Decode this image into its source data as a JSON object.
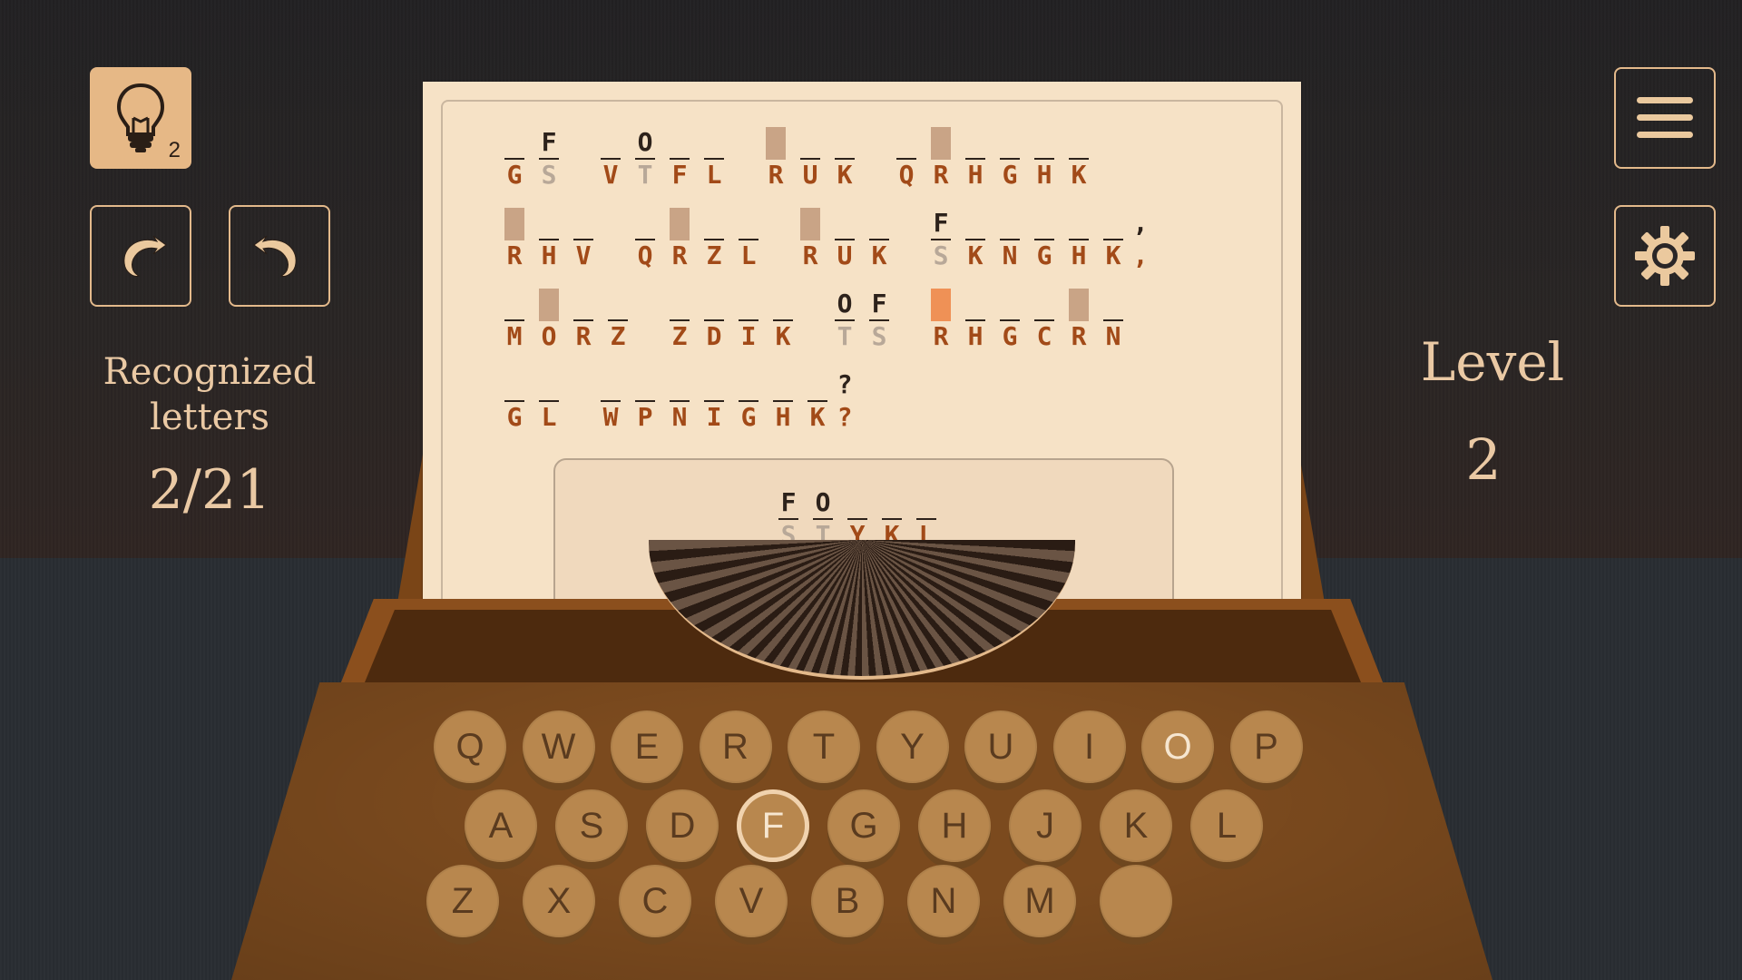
{
  "hud": {
    "hint_count": "2",
    "recognized_label": "Recognized letters",
    "recognized_count": "2/21",
    "level_label": "Level",
    "level_number": "2"
  },
  "icons": {
    "hint": "lightbulb-icon",
    "undo": "undo-arrow-icon",
    "redo": "redo-arrow-icon",
    "menu": "hamburger-menu-icon",
    "settings": "gear-icon"
  },
  "colors": {
    "accent": "#e6b886",
    "cipher_text": "#a24a18",
    "selected_cell": "#ef9156",
    "hinted_cell": "#c9a486",
    "paper": "#f6e2c6",
    "typewriter_body": "#7b4a1e"
  },
  "puzzle": {
    "lines": [
      [
        [
          {
            "g": "",
            "c": "G",
            "s": "uline"
          },
          {
            "g": "F",
            "c": "S",
            "s": "uline",
            "f": true
          }
        ],
        [
          {
            "g": "",
            "c": "V",
            "s": "uline"
          },
          {
            "g": "O",
            "c": "T",
            "s": "uline",
            "f": true
          },
          {
            "g": "",
            "c": "F",
            "s": "uline"
          },
          {
            "g": "",
            "c": "L",
            "s": "uline"
          }
        ],
        [
          {
            "g": "",
            "c": "R",
            "s": "shade"
          },
          {
            "g": "",
            "c": "U",
            "s": "uline"
          },
          {
            "g": "",
            "c": "K",
            "s": "uline"
          }
        ],
        [
          {
            "g": "",
            "c": "Q",
            "s": "uline"
          },
          {
            "g": "",
            "c": "R",
            "s": "shade"
          },
          {
            "g": "",
            "c": "H",
            "s": "uline"
          },
          {
            "g": "",
            "c": "G",
            "s": "uline"
          },
          {
            "g": "",
            "c": "H",
            "s": "uline"
          },
          {
            "g": "",
            "c": "K",
            "s": "uline"
          }
        ]
      ],
      [
        [
          {
            "g": "",
            "c": "R",
            "s": "shade"
          },
          {
            "g": "",
            "c": "H",
            "s": "uline"
          },
          {
            "g": "",
            "c": "V",
            "s": "uline"
          }
        ],
        [
          {
            "g": "",
            "c": "Q",
            "s": "uline"
          },
          {
            "g": "",
            "c": "R",
            "s": "shade"
          },
          {
            "g": "",
            "c": "Z",
            "s": "uline"
          },
          {
            "g": "",
            "c": "L",
            "s": "uline"
          }
        ],
        [
          {
            "g": "",
            "c": "R",
            "s": "shade"
          },
          {
            "g": "",
            "c": "U",
            "s": "uline"
          },
          {
            "g": "",
            "c": "K",
            "s": "uline"
          }
        ],
        [
          {
            "g": "F",
            "c": "S",
            "s": "uline",
            "f": true
          },
          {
            "g": "",
            "c": "K",
            "s": "uline"
          },
          {
            "g": "",
            "c": "N",
            "s": "uline"
          },
          {
            "g": "",
            "c": "G",
            "s": "uline"
          },
          {
            "g": "",
            "c": "H",
            "s": "uline"
          },
          {
            "g": "",
            "c": "K",
            "s": "uline"
          },
          {
            "g": ",",
            "c": ",",
            "s": "none",
            "p": true
          }
        ]
      ],
      [
        [
          {
            "g": "",
            "c": "M",
            "s": "uline"
          },
          {
            "g": "",
            "c": "O",
            "s": "shade"
          },
          {
            "g": "",
            "c": "R",
            "s": "uline"
          },
          {
            "g": "",
            "c": "Z",
            "s": "uline"
          }
        ],
        [
          {
            "g": "",
            "c": "Z",
            "s": "uline"
          },
          {
            "g": "",
            "c": "D",
            "s": "uline"
          },
          {
            "g": "",
            "c": "I",
            "s": "uline"
          },
          {
            "g": "",
            "c": "K",
            "s": "uline"
          }
        ],
        [
          {
            "g": "O",
            "c": "T",
            "s": "uline",
            "f": true
          },
          {
            "g": "F",
            "c": "S",
            "s": "uline",
            "f": true
          }
        ],
        [
          {
            "g": "",
            "c": "R",
            "s": "sel"
          },
          {
            "g": "",
            "c": "H",
            "s": "uline"
          },
          {
            "g": "",
            "c": "G",
            "s": "uline"
          },
          {
            "g": "",
            "c": "C",
            "s": "uline"
          },
          {
            "g": "",
            "c": "R",
            "s": "shade"
          },
          {
            "g": "",
            "c": "N",
            "s": "uline"
          }
        ]
      ],
      [
        [
          {
            "g": "",
            "c": "G",
            "s": "uline"
          },
          {
            "g": "",
            "c": "L",
            "s": "uline"
          }
        ],
        [
          {
            "g": "",
            "c": "W",
            "s": "uline"
          },
          {
            "g": "",
            "c": "P",
            "s": "uline"
          },
          {
            "g": "",
            "c": "N",
            "s": "uline"
          },
          {
            "g": "",
            "c": "I",
            "s": "uline"
          },
          {
            "g": "",
            "c": "G",
            "s": "uline"
          },
          {
            "g": "",
            "c": "H",
            "s": "uline"
          },
          {
            "g": "",
            "c": "K",
            "s": "uline"
          },
          {
            "g": "?",
            "c": "?",
            "s": "none",
            "p": true
          }
        ]
      ]
    ],
    "author": [
      [
        {
          "g": "F",
          "c": "S",
          "s": "uline",
          "f": true
        },
        {
          "g": "O",
          "c": "T",
          "s": "uline",
          "f": true
        },
        {
          "g": "",
          "c": "Y",
          "s": "uline"
        },
        {
          "g": "",
          "c": "K",
          "s": "uline"
        },
        {
          "g": "",
          "c": "L",
          "s": "uline"
        }
      ]
    ]
  },
  "keyboard": {
    "rows": [
      [
        "Q",
        "W",
        "E",
        "R",
        "T",
        "Y",
        "U",
        "I",
        "O",
        "P"
      ],
      [
        "A",
        "S",
        "D",
        "F",
        "G",
        "H",
        "J",
        "K",
        "L"
      ],
      [
        "Z",
        "X",
        "C",
        "V",
        "B",
        "N",
        "M",
        ""
      ]
    ],
    "active_key": "F",
    "found_keys": [
      "O"
    ]
  }
}
